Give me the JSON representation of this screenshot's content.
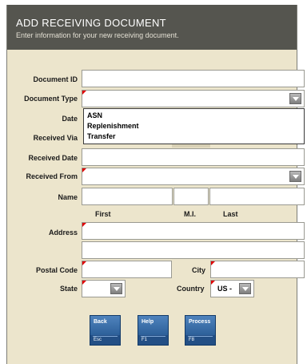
{
  "header": {
    "title": "ADD RECEIVING DOCUMENT",
    "subtitle": "Enter information for your new receiving document."
  },
  "labels": {
    "document_id": "Document ID",
    "document_type": "Document Type",
    "date": "Date",
    "received_via": "Received Via",
    "received_date": "Received Date",
    "received_from": "Received From",
    "name": "Name",
    "first": "First",
    "mi": "M.I.",
    "last": "Last",
    "address": "Address",
    "postal_code": "Postal Code",
    "city": "City",
    "state": "State",
    "country": "Country"
  },
  "values": {
    "country": "US -"
  },
  "document_type_options": [
    "ASN",
    "Replenishment",
    "Transfer"
  ],
  "buttons": {
    "back": {
      "label": "Back",
      "key": "Esc"
    },
    "help": {
      "label": "Help",
      "key": "F1"
    },
    "process": {
      "label": "Process",
      "key": "F8"
    }
  },
  "colors": {
    "header_bg": "#55554f",
    "panel_bg": "#ece5cc",
    "button_blue": "#1c4e87",
    "required_marker": "#e00000"
  }
}
